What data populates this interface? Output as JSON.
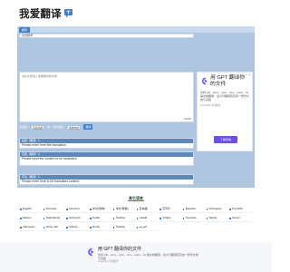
{
  "site": {
    "name": "我爱翻译"
  },
  "tab": {
    "active_label": "翻译"
  },
  "subbar": {
    "text": "在线翻译"
  },
  "input": {
    "placeholder": "请在这里输入需要翻译的内容",
    "char_count": "0/5000"
  },
  "controls": {
    "source_label": "原语言：",
    "source_value": "自动识别",
    "target_label": "目标语言：",
    "target_value": "简体中文",
    "swap_symbol": "⇄",
    "translate_label": "翻译"
  },
  "results": [
    {
      "head": "谷歌（翻译）0",
      "body": "Please enter here the translation"
    },
    {
      "head": "百度（翻译）0",
      "body": "Please input the content to be translated"
    },
    {
      "head": "有道（翻译）0",
      "body": "Please enter here to be translated content"
    }
  ],
  "ad": {
    "title": "用 GPT 翻译你的文件",
    "desc": "支持 pdf、docx、pptx、xlsx、epub、txt 等文档翻译，最大可翻译百页的一整份文档与表格",
    "site": "Simplified 文档翻译",
    "button": "了解详情",
    "mark_info": "i",
    "mark_close": "x",
    "accent": "#6b4fe0"
  },
  "languages": {
    "title": "其它语言",
    "items": [
      "English",
      "Français",
      "Deutsch",
      "中文(简体)",
      "中文(繁體)",
      "日本語",
      "한국어",
      "Español",
      "Português",
      "Русский",
      "Italiano",
      "Nederlands",
      "Ελληνικά",
      "Polski",
      "Čeština",
      "Català",
      "Türkçe",
      "Svenska",
      "Dansk",
      "Suomi",
      "Indonesia",
      "Tiếng Việt",
      "Melayu",
      "Norsk",
      "Čeština",
      "العربية"
    ]
  },
  "bottom_ad": {
    "title": "用 GPT 翻译你的文件",
    "desc": "支持 pdf、docx、pptx、xlsx、epub、txt 等文档翻译，最大可翻译百页的一整份文档与表格",
    "site": "Simplified 文档翻译"
  },
  "colors": {
    "panel": "#aec6df",
    "accent": "#3f7fcb"
  }
}
